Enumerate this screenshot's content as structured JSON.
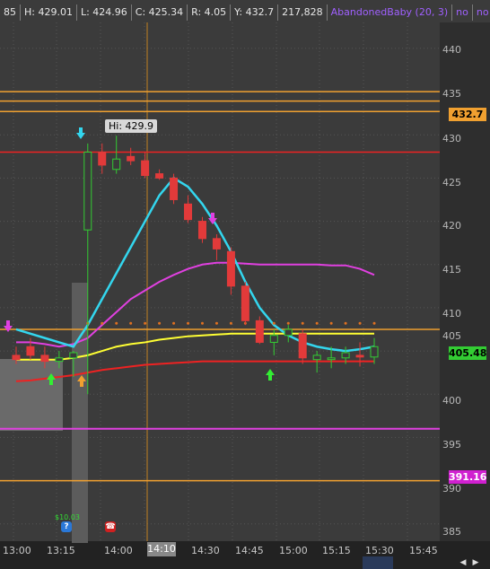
{
  "header": {
    "bar_prefix": "85",
    "high": "H: 429.01",
    "low": "L: 424.96",
    "close": "C: 425.34",
    "range": "R: 4.05",
    "prev_close": "Y: 432.7",
    "volume": "217,828",
    "study": "AbandonedBaby (20, 3)",
    "flag1": "no",
    "flag2": "no"
  },
  "tooltip": {
    "hi_label": "Hi: 429.9"
  },
  "price_tags": {
    "prev_close": "432.7",
    "last": "405.48",
    "lower": "391.16"
  },
  "y_axis": {
    "ticks": [
      "440",
      "435",
      "430",
      "425",
      "420",
      "415",
      "410",
      "405",
      "400",
      "395",
      "390",
      "385"
    ]
  },
  "x_axis": {
    "ticks": [
      "13:00",
      "13:15",
      "14:00",
      "14:30",
      "14:45",
      "15:00",
      "15:15",
      "15:30",
      "15:45"
    ],
    "cursor": "14:10"
  },
  "events": {
    "earnings_label": "$10.03"
  },
  "colors": {
    "background": "#3b3b3b",
    "bull_candle": "#3a3a3a",
    "bear_candle": "#e23a3a",
    "cyan_ma": "#33d6ee",
    "magenta_ma": "#e040e0",
    "yellow_ma": "#ffff33",
    "red_ma": "#ee2222",
    "orange_level": "#f0a030"
  },
  "chart_data": {
    "type": "candlestick",
    "ylim": [
      383,
      443
    ],
    "x": [
      "13:00",
      "13:05",
      "13:10",
      "13:15",
      "13:20",
      "13:25",
      "13:30",
      "13:35",
      "13:40",
      "13:45",
      "13:50",
      "13:55",
      "14:00",
      "14:05",
      "14:10",
      "14:15",
      "14:20",
      "14:25",
      "14:30",
      "14:35",
      "14:40",
      "14:45",
      "14:50",
      "14:55",
      "15:00",
      "15:05",
      "15:10",
      "15:15",
      "15:20",
      "15:25",
      "15:30",
      "15:35"
    ],
    "candles": [
      {
        "o": 404.5,
        "h": 405.5,
        "l": 403.5,
        "c": 404.0
      },
      {
        "o": 405.5,
        "h": 406.5,
        "l": 404.0,
        "c": 404.5
      },
      {
        "o": 404.5,
        "h": 405.5,
        "l": 403.0,
        "c": 403.8
      },
      {
        "o": 403.8,
        "h": 405.0,
        "l": 403.0,
        "c": 404.2
      },
      {
        "o": 404.2,
        "h": 405.0,
        "l": 402.0,
        "c": 404.8
      },
      {
        "o": 419.0,
        "h": 429.0,
        "l": 400.0,
        "c": 428.0
      },
      {
        "o": 428.0,
        "h": 429.0,
        "l": 425.5,
        "c": 426.5
      },
      {
        "o": 426.0,
        "h": 429.9,
        "l": 425.5,
        "c": 427.2
      },
      {
        "o": 427.5,
        "h": 428.5,
        "l": 426.5,
        "c": 427.0
      },
      {
        "o": 427.0,
        "h": 428.0,
        "l": 425.0,
        "c": 425.3
      },
      {
        "o": 425.5,
        "h": 426.0,
        "l": 424.8,
        "c": 425.0
      },
      {
        "o": 425.0,
        "h": 425.5,
        "l": 422.0,
        "c": 422.5
      },
      {
        "o": 422.0,
        "h": 423.0,
        "l": 419.8,
        "c": 420.2
      },
      {
        "o": 420.0,
        "h": 420.5,
        "l": 417.5,
        "c": 418.0
      },
      {
        "o": 418.0,
        "h": 418.5,
        "l": 415.5,
        "c": 416.8
      },
      {
        "o": 416.5,
        "h": 417.0,
        "l": 411.5,
        "c": 412.5
      },
      {
        "o": 412.5,
        "h": 413.0,
        "l": 408.0,
        "c": 408.5
      },
      {
        "o": 408.5,
        "h": 409.0,
        "l": 405.8,
        "c": 406.0
      },
      {
        "o": 406.0,
        "h": 407.5,
        "l": 404.5,
        "c": 406.8
      },
      {
        "o": 406.8,
        "h": 408.0,
        "l": 406.0,
        "c": 407.5
      },
      {
        "o": 407.0,
        "h": 407.5,
        "l": 403.5,
        "c": 404.2
      },
      {
        "o": 404.0,
        "h": 405.0,
        "l": 402.5,
        "c": 404.5
      },
      {
        "o": 404.0,
        "h": 405.5,
        "l": 403.0,
        "c": 404.2
      },
      {
        "o": 404.2,
        "h": 405.5,
        "l": 403.5,
        "c": 404.8
      },
      {
        "o": 404.5,
        "h": 406.0,
        "l": 403.2,
        "c": 404.3
      },
      {
        "o": 404.3,
        "h": 406.5,
        "l": 403.5,
        "c": 405.5
      }
    ],
    "studies": {
      "cyan": [
        407.5,
        407.0,
        406.5,
        406.0,
        405.5,
        408.0,
        411.0,
        414.0,
        417.0,
        420.0,
        423.0,
        425.0,
        424.0,
        422.0,
        419.5,
        416.5,
        413.0,
        410.0,
        408.0,
        406.8,
        406.0,
        405.5,
        405.2,
        405.0,
        405.2,
        405.5
      ],
      "magenta": [
        406.0,
        406.0,
        405.8,
        405.5,
        405.8,
        406.5,
        408.0,
        409.5,
        411.0,
        412.0,
        413.0,
        413.8,
        414.5,
        415.0,
        415.2,
        415.2,
        415.1,
        415.0,
        415.0,
        415.0,
        415.0,
        415.0,
        414.9,
        414.9,
        414.5,
        413.8
      ],
      "yellow": [
        404.0,
        404.0,
        404.0,
        404.0,
        404.2,
        404.5,
        405.0,
        405.5,
        405.8,
        406.0,
        406.3,
        406.5,
        406.7,
        406.8,
        406.9,
        407.0,
        407.0,
        407.0,
        407.0,
        407.0,
        407.0,
        407.0,
        407.0,
        407.0,
        407.0,
        407.0
      ],
      "red": [
        401.5,
        401.6,
        401.8,
        402.0,
        402.2,
        402.5,
        402.8,
        403.0,
        403.2,
        403.4,
        403.5,
        403.6,
        403.7,
        403.8,
        403.8,
        403.8,
        403.8,
        403.8,
        403.8,
        403.8,
        403.8,
        403.8,
        403.8,
        403.8,
        403.8,
        403.8
      ]
    },
    "levels": [
      435.0,
      433.9,
      432.7,
      428.0,
      407.5,
      396.0,
      390.0
    ]
  }
}
